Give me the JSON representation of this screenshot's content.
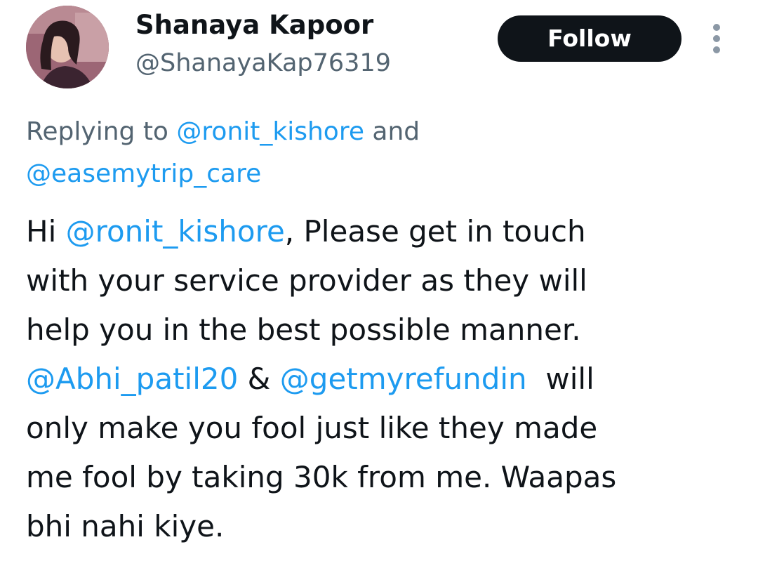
{
  "author": {
    "display_name": "Shanaya Kapoor",
    "handle": "@ShanayaKap76319",
    "avatar_icon": "profile-photo"
  },
  "actions": {
    "follow_label": "Follow",
    "more_icon": "more-vertical-icon"
  },
  "reply_context": {
    "prefix": "Replying to ",
    "mention_1": "@ronit_kishore",
    "joiner": " and",
    "mention_2": "@easemytrip_care"
  },
  "tweet": {
    "l1_a": "Hi ",
    "l1_mention": "@ronit_kishore",
    "l1_b": ", Please get in touch",
    "l2": "with your service provider as they will",
    "l3": "help you in the best possible manner.",
    "l4_mention_1": "@Abhi_patil20",
    "l4_sep": " & ",
    "l4_mention_2": "@getmyrefundin",
    "l4_b": "  will",
    "l5": "only make you fool just like they made",
    "l6": "me fool by taking 30k from me. Waapas",
    "l7": "bhi nahi kiye."
  },
  "colors": {
    "text": "#0f1419",
    "secondary": "#536471",
    "link": "#1d9bf0",
    "button_bg": "#0f1419"
  }
}
